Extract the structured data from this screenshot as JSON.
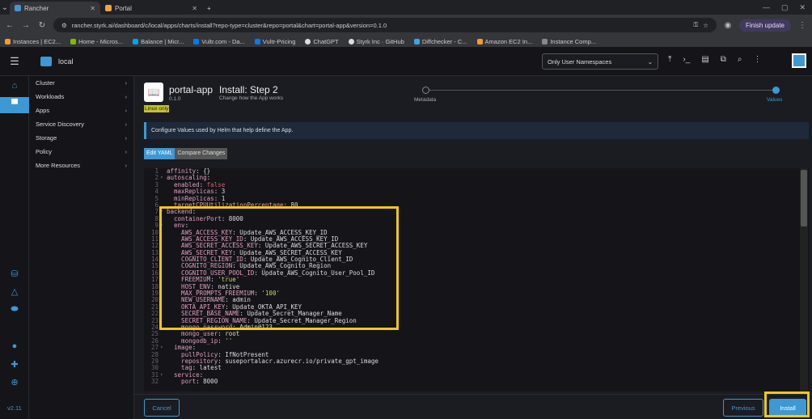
{
  "browser": {
    "tabs": [
      {
        "label": "Rancher",
        "color": "#3d98d3"
      },
      {
        "label": "Portal",
        "color": "#f2a33a"
      }
    ],
    "url": "rancher.styrk.ai/dashboard/c/local/apps/charts/install?repo-type=cluster&repo=portal&chart=portal-app&version=0.1.0",
    "finish_update": "Finish update",
    "bookmarks": [
      "Instances | EC2...",
      "Home - Micros...",
      "Balance | Micr...",
      "Vultr.com - Da...",
      "Vultr-Pricing",
      "ChatGPT",
      "Styrk Inc · GitHub",
      "Diffchecker - C...",
      "Amazon EC2 In...",
      "Instance Comp..."
    ]
  },
  "header": {
    "cluster": "local",
    "namespace_filter": "Only User Namespaces"
  },
  "rail": {
    "version": "v2.11"
  },
  "sidenav": [
    "Cluster",
    "Workloads",
    "Apps",
    "Service Discovery",
    "Storage",
    "Policy",
    "More Resources"
  ],
  "app": {
    "name": "portal-app",
    "version": "0.1.0",
    "badge": "Linux only",
    "step_title": "Install: Step 2",
    "step_subtitle": "Change how the App works",
    "steps": [
      "Metadata",
      "Values"
    ]
  },
  "banner": "Configure Values used by Helm that help define the App.",
  "editor_tabs": [
    "Edit YAML",
    "Compare Changes"
  ],
  "yaml_lines": [
    {
      "n": "1",
      "f": "",
      "k": "affinity",
      "v": " {}",
      "t": ""
    },
    {
      "n": "2",
      "f": "▾",
      "k": "autoscaling",
      "v": "",
      "t": ""
    },
    {
      "n": "3",
      "f": "",
      "k": "  enabled",
      "v": " false",
      "t": "b"
    },
    {
      "n": "4",
      "f": "",
      "k": "  maxReplicas",
      "v": " 3",
      "t": ""
    },
    {
      "n": "5",
      "f": "",
      "k": "  minReplicas",
      "v": " 1",
      "t": ""
    },
    {
      "n": "6",
      "f": "",
      "k": "  targetCPUUtilizationPercentage",
      "v": " 80",
      "t": ""
    },
    {
      "n": "7",
      "f": "▾",
      "k": "backend",
      "v": "",
      "t": ""
    },
    {
      "n": "8",
      "f": "",
      "k": "  containerPort",
      "v": " 8000",
      "t": ""
    },
    {
      "n": "9",
      "f": "▾",
      "k": "  env",
      "v": "",
      "t": ""
    },
    {
      "n": "10",
      "f": "",
      "k": "    AWS_ACCESS_KEY",
      "v": " Update_AWS_ACCESS_KEY_ID",
      "t": ""
    },
    {
      "n": "11",
      "f": "",
      "k": "    AWS_ACCESS_KEY_ID",
      "v": " Update_AWS_ACCESS_KEY_ID",
      "t": ""
    },
    {
      "n": "12",
      "f": "",
      "k": "    AWS_SECRET_ACCESS_KEY",
      "v": " Update_AWS_SECRET_ACCESS_KEY",
      "t": ""
    },
    {
      "n": "13",
      "f": "",
      "k": "    AWS_SECRET_KEY",
      "v": " Update_AWS_SECRET_ACCESS_KEY",
      "t": ""
    },
    {
      "n": "14",
      "f": "",
      "k": "    COGNITO_CLIENT_ID",
      "v": " Update_AWS_Cognito_Client_ID",
      "t": ""
    },
    {
      "n": "15",
      "f": "",
      "k": "    COGNITO_REGION",
      "v": " Update_AWS_Cognito_Region",
      "t": ""
    },
    {
      "n": "16",
      "f": "",
      "k": "    COGNITO_USER_POOL_ID",
      "v": " Update_AWS_Cognito_User_Pool_ID",
      "t": ""
    },
    {
      "n": "17",
      "f": "",
      "k": "    FREEMIUM",
      "v": " 'true'",
      "t": "s"
    },
    {
      "n": "18",
      "f": "",
      "k": "    HOST_ENV",
      "v": " native",
      "t": ""
    },
    {
      "n": "19",
      "f": "",
      "k": "    MAX_PROMPTS_FREEMIUM",
      "v": " '100'",
      "t": "s"
    },
    {
      "n": "20",
      "f": "",
      "k": "    NEW_USERNAME",
      "v": " admin",
      "t": ""
    },
    {
      "n": "21",
      "f": "",
      "k": "    OKTA_API_KEY",
      "v": " Update_OKTA_API_KEY",
      "t": ""
    },
    {
      "n": "22",
      "f": "",
      "k": "    SECRET_BASE_NAME",
      "v": " Update_Secret_Manager_Name",
      "t": ""
    },
    {
      "n": "23",
      "f": "",
      "k": "    SECRET_REGION_NAME",
      "v": " Update_Secret_Manager_Region",
      "t": ""
    },
    {
      "n": "24",
      "f": "",
      "k": "    mongo_password",
      "v": " Admin@123",
      "t": ""
    },
    {
      "n": "25",
      "f": "",
      "k": "    mongo_user",
      "v": " root",
      "t": ""
    },
    {
      "n": "26",
      "f": "",
      "k": "    mongodb_ip",
      "v": " ''",
      "t": "s"
    },
    {
      "n": "27",
      "f": "▾",
      "k": "  image",
      "v": "",
      "t": ""
    },
    {
      "n": "28",
      "f": "",
      "k": "    pullPolicy",
      "v": " IfNotPresent",
      "t": ""
    },
    {
      "n": "29",
      "f": "",
      "k": "    repository",
      "v": " suseportalacr.azurecr.io/private_gpt_image",
      "t": ""
    },
    {
      "n": "30",
      "f": "",
      "k": "    tag",
      "v": " latest",
      "t": ""
    },
    {
      "n": "31",
      "f": "▾",
      "k": "  service",
      "v": "",
      "t": ""
    },
    {
      "n": "32",
      "f": "",
      "k": "    port",
      "v": " 8000",
      "t": ""
    }
  ],
  "footer": {
    "cancel": "Cancel",
    "previous": "Previous",
    "install": "Install"
  }
}
